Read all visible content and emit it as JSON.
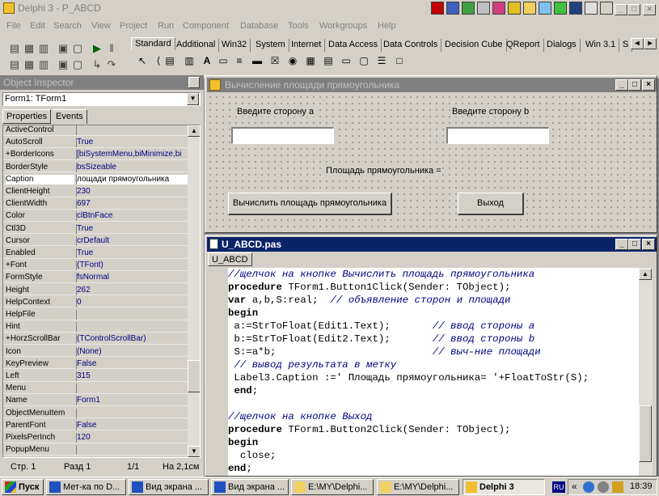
{
  "main": {
    "title": "Delphi 3 - P_ABCD",
    "menu": [
      "File",
      "Edit",
      "Search",
      "View",
      "Project",
      "Run",
      "Component",
      "Database",
      "Tools",
      "Workgroups",
      "Help"
    ],
    "palette_tabs": [
      "Standard",
      "Additional",
      "Win32",
      "System",
      "Internet",
      "Data Access",
      "Data Controls",
      "Decision Cube",
      "QReport",
      "Dialogs",
      "Win 3.1",
      "S"
    ]
  },
  "inspector": {
    "title": "Object Inspector",
    "combo": "Form1: TForm1",
    "tabs": [
      "Properties",
      "Events"
    ],
    "props": [
      {
        "name": "ActiveControl",
        "value": ""
      },
      {
        "name": "AutoScroll",
        "value": "True"
      },
      {
        "name": "+BorderIcons",
        "value": "[biSystemMenu,biMinimize,bi"
      },
      {
        "name": "BorderStyle",
        "value": "bsSizeable"
      },
      {
        "name": "Caption",
        "value": "лощади прямоугольника"
      },
      {
        "name": "ClientHeight",
        "value": "230"
      },
      {
        "name": "ClientWidth",
        "value": "697"
      },
      {
        "name": "Color",
        "value": "clBtnFace"
      },
      {
        "name": "Ctl3D",
        "value": "True"
      },
      {
        "name": "Cursor",
        "value": "crDefault"
      },
      {
        "name": "Enabled",
        "value": "True"
      },
      {
        "name": "+Font",
        "value": "(TFont)"
      },
      {
        "name": "FormStyle",
        "value": "fsNormal"
      },
      {
        "name": "Height",
        "value": "262"
      },
      {
        "name": "HelpContext",
        "value": "0"
      },
      {
        "name": "HelpFile",
        "value": ""
      },
      {
        "name": "Hint",
        "value": ""
      },
      {
        "name": "+HorzScrollBar",
        "value": "(TControlScrollBar)"
      },
      {
        "name": "Icon",
        "value": "(None)"
      },
      {
        "name": "KeyPreview",
        "value": "False"
      },
      {
        "name": "Left",
        "value": "315"
      },
      {
        "name": "Menu",
        "value": ""
      },
      {
        "name": "Name",
        "value": "Form1"
      },
      {
        "name": "ObjectMenuItem",
        "value": ""
      },
      {
        "name": "ParentFont",
        "value": "False"
      },
      {
        "name": "PixelsPerInch",
        "value": "120"
      },
      {
        "name": "PopupMenu",
        "value": ""
      }
    ],
    "status": {
      "page": "Стр. 1",
      "section": "Разд 1",
      "pages": "1/1",
      "pos": "На 2,1см"
    }
  },
  "form": {
    "title": "Вычисление площади прямоугольника",
    "label_a": "Введите сторону а",
    "label_b": "Введите сторону b",
    "label_result": "Площадь прямоугольника =",
    "btn_calc": "Вычислить площадь прямоугольника",
    "btn_exit": "Выход"
  },
  "editor": {
    "title": "U_ABCD.pas",
    "tab": "U_ABCD",
    "lines": [
      [
        {
          "t": "//щелчок на кнопке Вычислить площадь прямоугольника",
          "c": "cm"
        }
      ],
      [
        {
          "t": "procedure",
          "c": "kw"
        },
        {
          "t": " TForm1.Button1Click(Sender: TObject);",
          "c": ""
        }
      ],
      [
        {
          "t": "var",
          "c": "kw"
        },
        {
          "t": " a,b,S:real;  ",
          "c": ""
        },
        {
          "t": "// объявление сторон и площади",
          "c": "cm"
        }
      ],
      [
        {
          "t": "begin",
          "c": "kw"
        }
      ],
      [
        {
          "t": " a:=StrToFloat(Edit1.Text);       ",
          "c": ""
        },
        {
          "t": "// ввод стороны a",
          "c": "cm"
        }
      ],
      [
        {
          "t": " b:=StrToFloat(Edit2.Text);       ",
          "c": ""
        },
        {
          "t": "// ввод стороны b",
          "c": "cm"
        }
      ],
      [
        {
          "t": " S:=a*b;                          ",
          "c": ""
        },
        {
          "t": "// выч-ние площади",
          "c": "cm"
        }
      ],
      [
        {
          "t": " ",
          "c": ""
        },
        {
          "t": "// вывод результата в метку",
          "c": "cm"
        }
      ],
      [
        {
          "t": " Label3.Caption :=' Площадь прямоугольника= '+FloatToStr(S);",
          "c": ""
        }
      ],
      [
        {
          "t": " ",
          "c": ""
        },
        {
          "t": "end",
          "c": "kw"
        },
        {
          "t": ";",
          "c": ""
        }
      ],
      [
        {
          "t": "",
          "c": ""
        }
      ],
      [
        {
          "t": "//щелчок на кнопке Выход",
          "c": "cm"
        }
      ],
      [
        {
          "t": "procedure",
          "c": "kw"
        },
        {
          "t": " TForm1.Button2Click(Sender: TObject);",
          "c": ""
        }
      ],
      [
        {
          "t": "begin",
          "c": "kw"
        }
      ],
      [
        {
          "t": "  close;",
          "c": ""
        }
      ],
      [
        {
          "t": "end",
          "c": "kw"
        },
        {
          "t": ";",
          "c": ""
        }
      ]
    ]
  },
  "taskbar": {
    "start": "Пуск",
    "buttons": [
      "Мет-ка по D...",
      "Вид экрана ...",
      "Вид экрана ...",
      "E:\\MY\\Delphi...",
      "E:\\MY\\Delphi...",
      "Delphi 3"
    ],
    "lang": "RU",
    "time": "18:39"
  }
}
